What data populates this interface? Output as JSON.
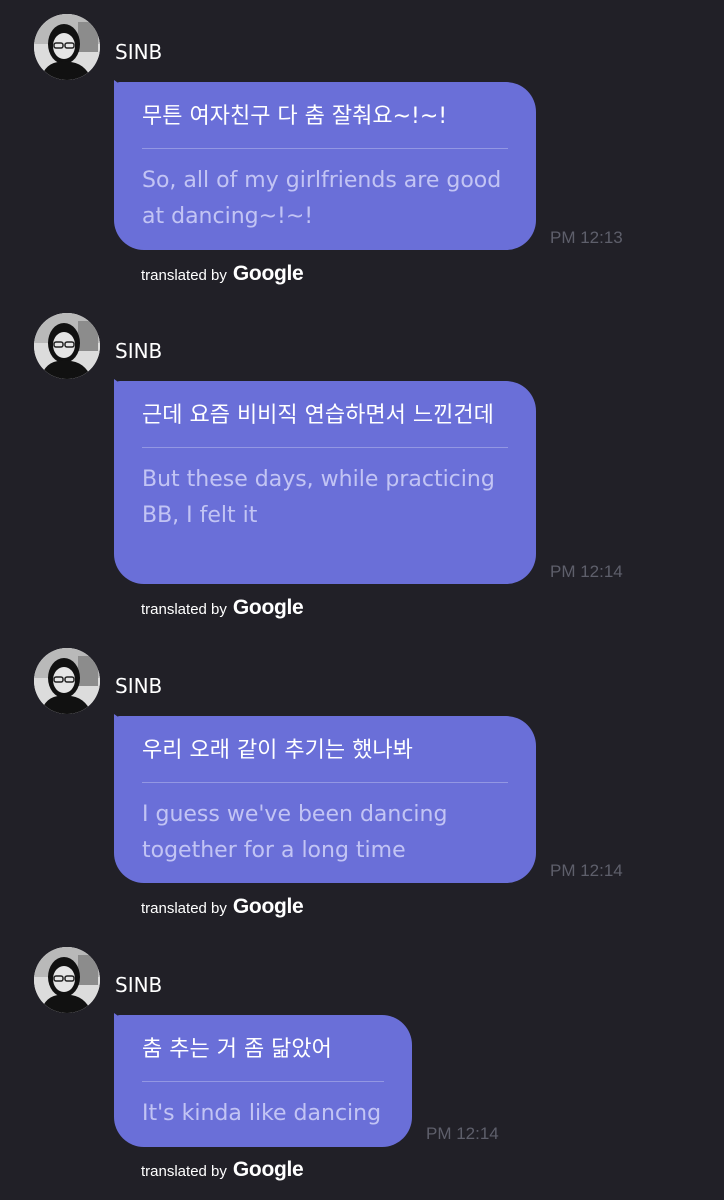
{
  "messages": [
    {
      "sender": "SINB",
      "korean": "무튼 여자친구 다 춤 잘춰요~!~!",
      "english": "So, all of my girlfriends are good at dancing~!~!",
      "time": "PM 12:13",
      "translated_label": "translated by",
      "translated_brand": "Google"
    },
    {
      "sender": "SINB",
      "korean": "근데 요즘 비비직 연습하면서 느낀건데",
      "english": "But these days, while practicing BB, I felt it",
      "time": "PM 12:14",
      "translated_label": "translated by",
      "translated_brand": "Google"
    },
    {
      "sender": "SINB",
      "korean": "우리 오래 같이 추기는 했나봐",
      "english": "I guess we've been dancing together for a long time",
      "time": "PM 12:14",
      "translated_label": "translated by",
      "translated_brand": "Google"
    },
    {
      "sender": "SINB",
      "korean": "춤 추는 거 좀 닮았어",
      "english": "It's kinda like dancing",
      "time": "PM 12:14",
      "translated_label": "translated by",
      "translated_brand": "Google"
    }
  ],
  "colors": {
    "background": "#212027",
    "bubble": "#6a6fd8",
    "timestamp": "#5e5f6b"
  },
  "icons": {
    "avatar": "profile-photo"
  }
}
